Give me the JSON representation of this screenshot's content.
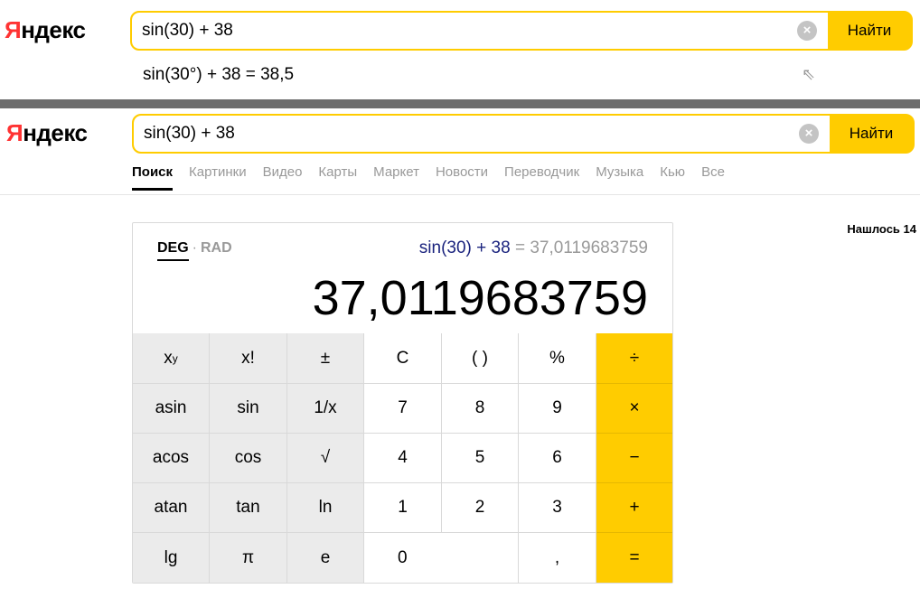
{
  "top_panel": {
    "logo_first": "Я",
    "logo_rest": "ндекс",
    "search_value": "sin(30) + 38",
    "clear_icon": "×",
    "search_button": "Найти",
    "suggestion": "sin(30°) + 38 = 38,5",
    "suggestion_arrow": "⇖"
  },
  "bottom_panel": {
    "logo_first": "Я",
    "logo_rest": "ндекс",
    "search_value": "sin(30) + 38",
    "clear_icon": "×",
    "search_button": "Найти",
    "tabs": [
      "Поиск",
      "Картинки",
      "Видео",
      "Карты",
      "Маркет",
      "Новости",
      "Переводчик",
      "Музыка",
      "Кью",
      "Все"
    ],
    "found_text": "Нашлось 14"
  },
  "calculator": {
    "mode_deg": "DEG",
    "mode_sep": "·",
    "mode_rad": "RAD",
    "expression": "sin(30) + 38",
    "expression_eq": " = 37,0119683759",
    "result": "37,0119683759",
    "keys": {
      "pow_base": "x",
      "pow_exp": "y",
      "fact": "x!",
      "plusminus": "±",
      "clear": "C",
      "parens": "( )",
      "percent": "%",
      "divide": "÷",
      "asin": "asin",
      "sin": "sin",
      "inverse": "1/x",
      "d7": "7",
      "d8": "8",
      "d9": "9",
      "multiply": "×",
      "acos": "acos",
      "cos": "cos",
      "sqrt": "√",
      "d4": "4",
      "d5": "5",
      "d6": "6",
      "minus": "−",
      "atan": "atan",
      "tan": "tan",
      "ln": "ln",
      "d1": "1",
      "d2": "2",
      "d3": "3",
      "plus": "+",
      "lg": "lg",
      "pi": "π",
      "e": "e",
      "d0": "0",
      "comma": ",",
      "equals": "="
    }
  },
  "colors": {
    "accent_yellow": "#ffcc00",
    "logo_red": "#ff3333",
    "divider_gray": "#6d6d6d"
  }
}
